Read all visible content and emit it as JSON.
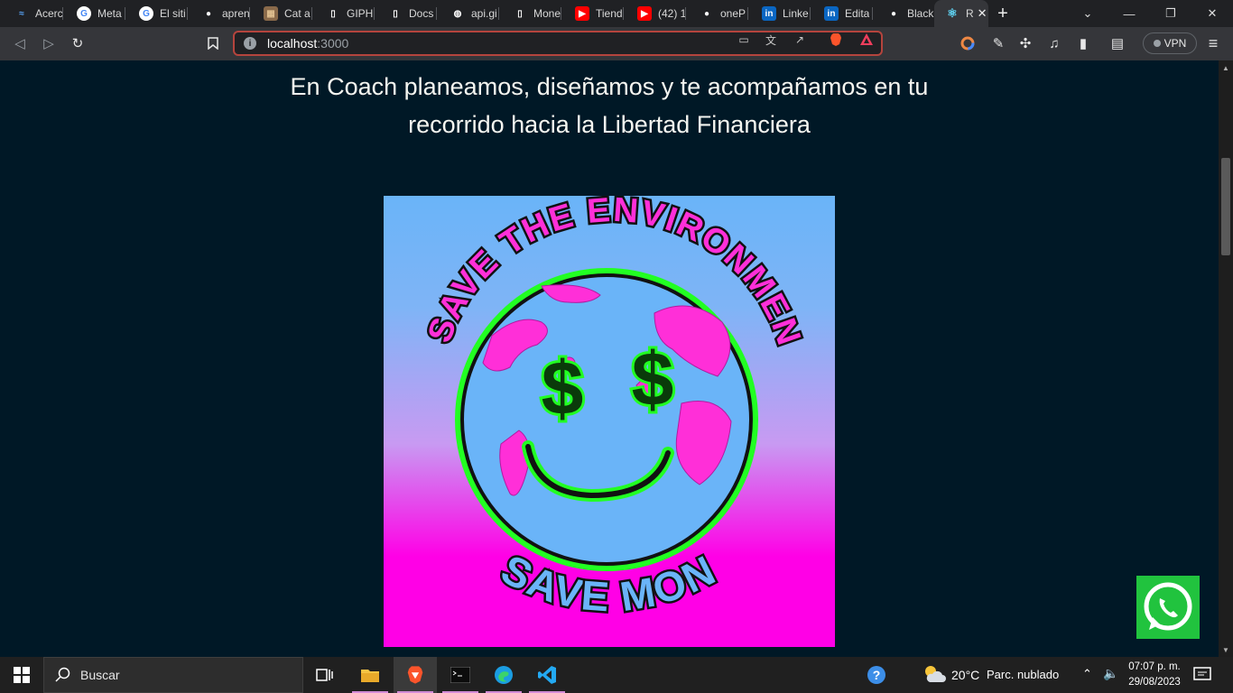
{
  "browser": {
    "tabs": [
      {
        "label": "Acerc",
        "icon": "wave-icon"
      },
      {
        "label": "Meta",
        "icon": "google-icon"
      },
      {
        "label": "El siti",
        "icon": "google-icon"
      },
      {
        "label": "apren",
        "icon": "github-icon"
      },
      {
        "label": "Cat a",
        "icon": "cat-image-icon"
      },
      {
        "label": "GIPH",
        "icon": "document-icon"
      },
      {
        "label": "Docs",
        "icon": "document-icon"
      },
      {
        "label": "api.gi",
        "icon": "globe-icon"
      },
      {
        "label": "Mone",
        "icon": "document-icon"
      },
      {
        "label": "Tiend",
        "icon": "youtube-icon"
      },
      {
        "label": "(42) 1",
        "icon": "youtube-icon"
      },
      {
        "label": "oneP",
        "icon": "github-icon"
      },
      {
        "label": "Linke",
        "icon": "linkedin-icon"
      },
      {
        "label": "Edita",
        "icon": "linkedin-icon"
      },
      {
        "label": "BlackF",
        "icon": "github-icon"
      }
    ],
    "active_tab": {
      "label": "R",
      "icon": "react-icon"
    },
    "url_host": "localhost",
    "url_port": ":3000",
    "vpn_label": "VPN"
  },
  "page": {
    "headline_line1": "En Coach planeamos, diseñamos y te acompañamos en tu",
    "headline_line2": "recorrido hacia la Libertad Financiera",
    "poster": {
      "top_text": "SAVE THE ENVIRONMENT",
      "bottom_text": "SAVE MONEY",
      "eye_symbol": "$",
      "colors": {
        "sky_top": "#6ab4f8",
        "sky_bottom": "#ff00e6",
        "land": "#ff2fd8",
        "ocean": "#6ab4f8",
        "glow": "#22ff22"
      }
    },
    "background_color": "#001826"
  },
  "taskbar": {
    "search_label": "Buscar",
    "weather_temp": "20°C",
    "weather_desc": "Parc. nublado",
    "time": "07:07 p. m.",
    "date": "29/08/2023"
  }
}
